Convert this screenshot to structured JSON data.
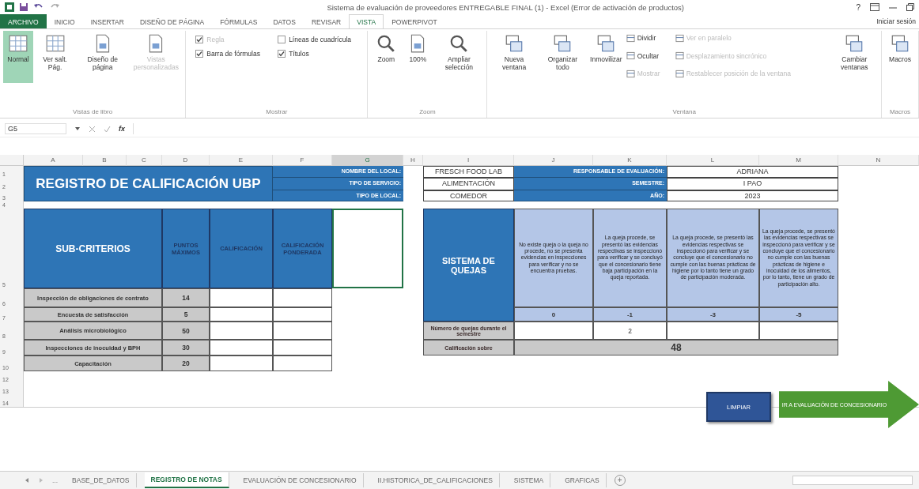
{
  "window": {
    "title": "Sistema de evaluación de proveedores ENTREGABLE FINAL (1) - Excel (Error de activación de productos)",
    "help": "?",
    "sign_in": "Iniciar sesión"
  },
  "ribbon_tabs": [
    {
      "label": "ARCHIVO",
      "kind": "file",
      "selected": false
    },
    {
      "label": "INICIO",
      "kind": "tab",
      "selected": false
    },
    {
      "label": "INSERTAR",
      "kind": "tab",
      "selected": false
    },
    {
      "label": "DISEÑO DE PÁGINA",
      "kind": "tab",
      "selected": false
    },
    {
      "label": "FÓRMULAS",
      "kind": "tab",
      "selected": false
    },
    {
      "label": "DATOS",
      "kind": "tab",
      "selected": false
    },
    {
      "label": "REVISAR",
      "kind": "tab",
      "selected": false
    },
    {
      "label": "VISTA",
      "kind": "tab",
      "selected": true
    },
    {
      "label": "POWERPIVOT",
      "kind": "tab",
      "selected": false
    }
  ],
  "ribbon_groups": [
    {
      "name": "Vistas de libro",
      "items": [
        {
          "kind": "big",
          "label": "Normal",
          "selected": true,
          "disabled": false
        },
        {
          "kind": "big",
          "label": "Ver salt. Pág.",
          "selected": false,
          "disabled": false
        },
        {
          "kind": "big",
          "label": "Diseño de página",
          "selected": false,
          "disabled": false
        },
        {
          "kind": "big",
          "label": "Vistas personalizadas",
          "selected": false,
          "disabled": true
        }
      ]
    },
    {
      "name": "Mostrar",
      "items": [
        {
          "kind": "check",
          "label": "Regla",
          "checked": true,
          "disabled": true
        },
        {
          "kind": "check",
          "label": "Líneas de cuadrícula",
          "checked": false,
          "disabled": false
        },
        {
          "kind": "check",
          "label": "Barra de fórmulas",
          "checked": true,
          "disabled": false
        },
        {
          "kind": "check",
          "label": "Títulos",
          "checked": true,
          "disabled": false
        }
      ]
    },
    {
      "name": "Zoom",
      "items": [
        {
          "kind": "big",
          "label": "Zoom",
          "selected": false,
          "disabled": false
        },
        {
          "kind": "big",
          "label": "100%",
          "selected": false,
          "disabled": false
        },
        {
          "kind": "big",
          "label": "Ampliar selección",
          "selected": false,
          "disabled": false
        }
      ]
    },
    {
      "name": "Ventana",
      "items": [
        {
          "kind": "big",
          "label": "Nueva ventana",
          "selected": false,
          "disabled": false
        },
        {
          "kind": "big",
          "label": "Organizar todo",
          "selected": false,
          "disabled": false
        },
        {
          "kind": "big",
          "label": "Inmovilizar",
          "selected": false,
          "disabled": false
        },
        {
          "kind": "small",
          "label": "Dividir",
          "disabled": false
        },
        {
          "kind": "small",
          "label": "Ocultar",
          "disabled": false
        },
        {
          "kind": "small",
          "label": "Mostrar",
          "disabled": true
        },
        {
          "kind": "small",
          "label": "Ver en paralelo",
          "disabled": true
        },
        {
          "kind": "small",
          "label": "Desplazamiento sincrónico",
          "disabled": true
        },
        {
          "kind": "small",
          "label": "Restablecer posición de la ventana",
          "disabled": true
        },
        {
          "kind": "big",
          "label": "Cambiar ventanas",
          "selected": false,
          "disabled": false
        }
      ]
    },
    {
      "name": "Macros",
      "items": [
        {
          "kind": "big",
          "label": "Macros",
          "selected": false,
          "disabled": false
        }
      ]
    }
  ],
  "formula_bar": {
    "name_box": "G5",
    "fx": "fx"
  },
  "columns": [
    "A",
    "B",
    "C",
    "D",
    "E",
    "F",
    "G",
    "H",
    "I",
    "J",
    "K",
    "L",
    "M",
    "N"
  ],
  "row_numbers": [
    "1",
    "2",
    "3",
    "4",
    "5",
    "6",
    "7",
    "8",
    "9",
    "10",
    "12",
    "13",
    "14"
  ],
  "title": "REGISTRO DE CALIFICACIÓN UBP",
  "info_left": [
    {
      "label": "NOMBRE DEL LOCAL:",
      "value": "FRESCH FOOD LAB"
    },
    {
      "label": "TIPO DE SERVICIO:",
      "value": "ALIMENTACIÓN"
    },
    {
      "label": "TIPO DE LOCAL:",
      "value": "COMEDOR"
    }
  ],
  "info_right": [
    {
      "label": "RESPONSABLE DE EVALUACIÓN:",
      "value": "ADRIANA"
    },
    {
      "label": "SEMESTRE:",
      "value": "I PAO"
    },
    {
      "label": "AÑO:",
      "value": "2023"
    }
  ],
  "criteria_table": {
    "columns": [
      "SUB-CRITERIOS",
      "PUNTOS MÁXIMOS",
      "CALIFICACIÓN",
      "CALIFICACIÓN PONDERADA"
    ],
    "rows": [
      {
        "name": "Inspección de obligaciones de contrato",
        "points": "14"
      },
      {
        "name": "Encuesta de satisfacción",
        "points": "5"
      },
      {
        "name": "Análisis microbiológico",
        "points": "50"
      },
      {
        "name": "Inspecciones de inocuidad y BPH",
        "points": "30"
      },
      {
        "name": "Capacitación",
        "points": "20"
      }
    ]
  },
  "complaints": {
    "title": "SISTEMA DE QUEJAS",
    "levels": [
      {
        "description": "No existe queja o la queja no procede, no se presenta evidencias en inspecciones para verificar y no se encuentra pruebas.",
        "value": "0"
      },
      {
        "description": "La queja procede, se presentó las evidencias respectivas se inspeccionó para verificar y se concluyó que el concesionario tiene baja participación en la queja reportada.",
        "value": "-1",
        "count": "2"
      },
      {
        "description": "La queja procede, se presentó las evidencias respectivas se inspeccionó para verificar y se concluye que el concesionario no cumple con las buenas prácticas de higiene por lo tanto tiene un grado de participación moderada.",
        "value": "-3"
      },
      {
        "description": "La queja procede, se presentó las evidencias respectivas se inspeccionó para verificar y se concluye que el concesionario no cumple con las buenas prácticas de higiene e inocuidad de los alimentos, por lo tanto, tiene un grado de participación alto.",
        "value": "-5"
      }
    ],
    "count_label": "Número de quejas durante el semestre",
    "score_label": "Calificación sobre",
    "score": "48"
  },
  "buttons": {
    "clear": "LIMPIAR",
    "next": "IR A EVALUACIÓN DE CONCESIONARIO"
  },
  "sheet_tabs": [
    {
      "label": "BASE_DE_DATOS",
      "selected": false
    },
    {
      "label": "REGISTRO DE NOTAS",
      "selected": true
    },
    {
      "label": "EVALUACIÓN DE CONCESIONARIO",
      "selected": false
    },
    {
      "label": "II.HISTORICA_DE_CALIFICACIONES",
      "selected": false
    },
    {
      "label": "SISTEMA",
      "selected": false
    },
    {
      "label": "GRAFICAS",
      "selected": false
    }
  ],
  "sheet_nav": {
    "more": "...",
    "add": "+"
  }
}
